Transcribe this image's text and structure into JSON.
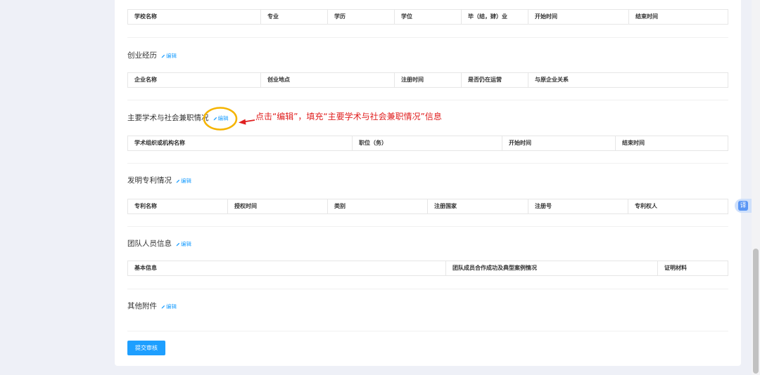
{
  "education": {
    "columns": [
      "学校名称",
      "专业",
      "学历",
      "学位",
      "毕（结，肄）业",
      "开始时间",
      "结束时间"
    ]
  },
  "entrepreneurship": {
    "title": "创业经历",
    "columns": [
      "企业名称",
      "创业地点",
      "注册时间",
      "是否仍在运营",
      "与原企业关系"
    ]
  },
  "academic": {
    "title": "主要学术与社会兼职情况",
    "columns": [
      "学术组织或机构名称",
      "职位（务）",
      "开始时间",
      "结束时间"
    ]
  },
  "patents": {
    "title": "发明专利情况",
    "columns": [
      "专利名称",
      "授权时间",
      "类别",
      "注册国家",
      "注册号",
      "专利权人"
    ]
  },
  "team": {
    "title": "团队人员信息",
    "columns": [
      "基本信息",
      "团队成员合作成功及典型案例情况",
      "证明材料"
    ]
  },
  "attachments": {
    "title": "其他附件"
  },
  "edit_label": "编辑",
  "edit_icon": "pencil-icon",
  "annotation": {
    "text": "点击“编辑”，填充“主要学术与社会兼职情况”信息"
  },
  "submit": {
    "label": "提交审核"
  },
  "translate_button": {
    "label": "译"
  },
  "colors": {
    "accent": "#1e9fff",
    "background": "#eef0f7",
    "card": "#ffffff",
    "annotation_red": "#e02020",
    "highlight_yellow": "#f5b400"
  }
}
